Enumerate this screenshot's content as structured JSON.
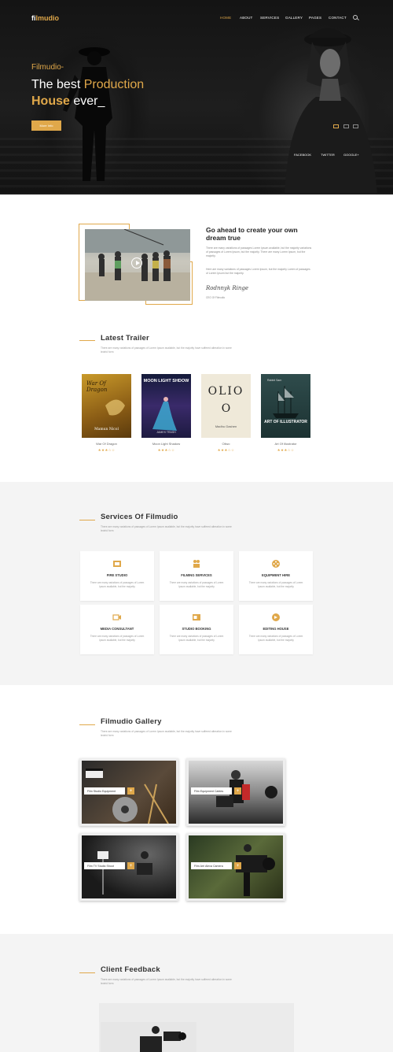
{
  "brand": {
    "logo_prefix": "fi",
    "logo_rest": "lmudio",
    "accent": "#e0a84a"
  },
  "nav": {
    "items": [
      "HOME",
      "ABOUT",
      "SERVICES",
      "GALLERY",
      "PAGES",
      "CONTACT"
    ],
    "active": "HOME"
  },
  "hero": {
    "eyebrow": "Filmudio-",
    "title_part1": "The best ",
    "title_highlight1": "Production",
    "title_highlight2": "House",
    "title_part2": " ever_",
    "button": "More Info",
    "social": [
      "FACEBOOK",
      "TWITTER",
      "GOOGLE+"
    ]
  },
  "about": {
    "title": "Go ahead to create your own dream true",
    "para1": "There are many variations of passages Lorem Ipsum available, but the majority variations of passages of Lorem Ipsum, but the majority. There are many Lorem Ipsum, but the majority.",
    "para2": "Here are many variations of passages Lorem Ipsum, but the majority Lorem of passages of Lorem Ipsum but the majority.",
    "signature": "Rodnnyk Ringe",
    "sign_name": "CEO Of Filmudio"
  },
  "trailers": {
    "title": "Latest Trailer",
    "subtitle": "There are many variations of passages of Lorem Ipsum available, but the majority have suffered alteration in some leotrid form",
    "items": [
      {
        "name": "War Of Dragon",
        "stars": "★★★☆☆",
        "cover_title": "War Of Dragon",
        "cover_author": "Mamun Nicol"
      },
      {
        "name": "Moon Light Shadow",
        "stars": "★★★☆☆",
        "cover_title": "MOON LIGHT SHDOW",
        "cover_author": "JAMES TRASH"
      },
      {
        "name": "Oliwo",
        "stars": "★★★☆☆",
        "cover_title": "OLIO",
        "cover_author": "Madhu Gashen"
      },
      {
        "name": "Art Of Illustrator",
        "stars": "★★★☆☆",
        "cover_title": "ART OF ILLUSTRATOR",
        "cover_author": "Rabbit Sam"
      }
    ]
  },
  "services": {
    "title": "Services Of Filmudio",
    "subtitle": "There are many variations of passages of Lorem Ipsum available, but the majority have suffered alteration in some leotrid form",
    "desc": "There are many variations of passages of Lorem Ipsum available, but the majority",
    "items": [
      {
        "title": "FIRE STUDIO",
        "icon": "film-studio-icon"
      },
      {
        "title": "FILMING SERVICES",
        "icon": "camera-crew-icon"
      },
      {
        "title": "EQUIPMENT HIRE",
        "icon": "film-reel-icon"
      },
      {
        "title": "MEDIA CONSULTANT",
        "icon": "media-icon"
      },
      {
        "title": "STUDIO BOOKING",
        "icon": "booking-icon"
      },
      {
        "title": "EDITING HOUSE",
        "icon": "editing-icon"
      }
    ]
  },
  "gallery": {
    "title": "Filmudio Gallery",
    "subtitle": "There are many variations of passages of Lorem Ipsum available, but the majority have suffered alteration in some leotrid form",
    "items": [
      "Film Studio Equipment",
      "Film Equipment Cables",
      "Film TV Studio Shoot",
      "Film Arri Alexa Camera"
    ],
    "plus": "+"
  },
  "feedback": {
    "title": "Client Feedback",
    "subtitle": "There are many variations of passages of Lorem Ipsum available, but the majority have suffered alteration in some leotrid form"
  }
}
